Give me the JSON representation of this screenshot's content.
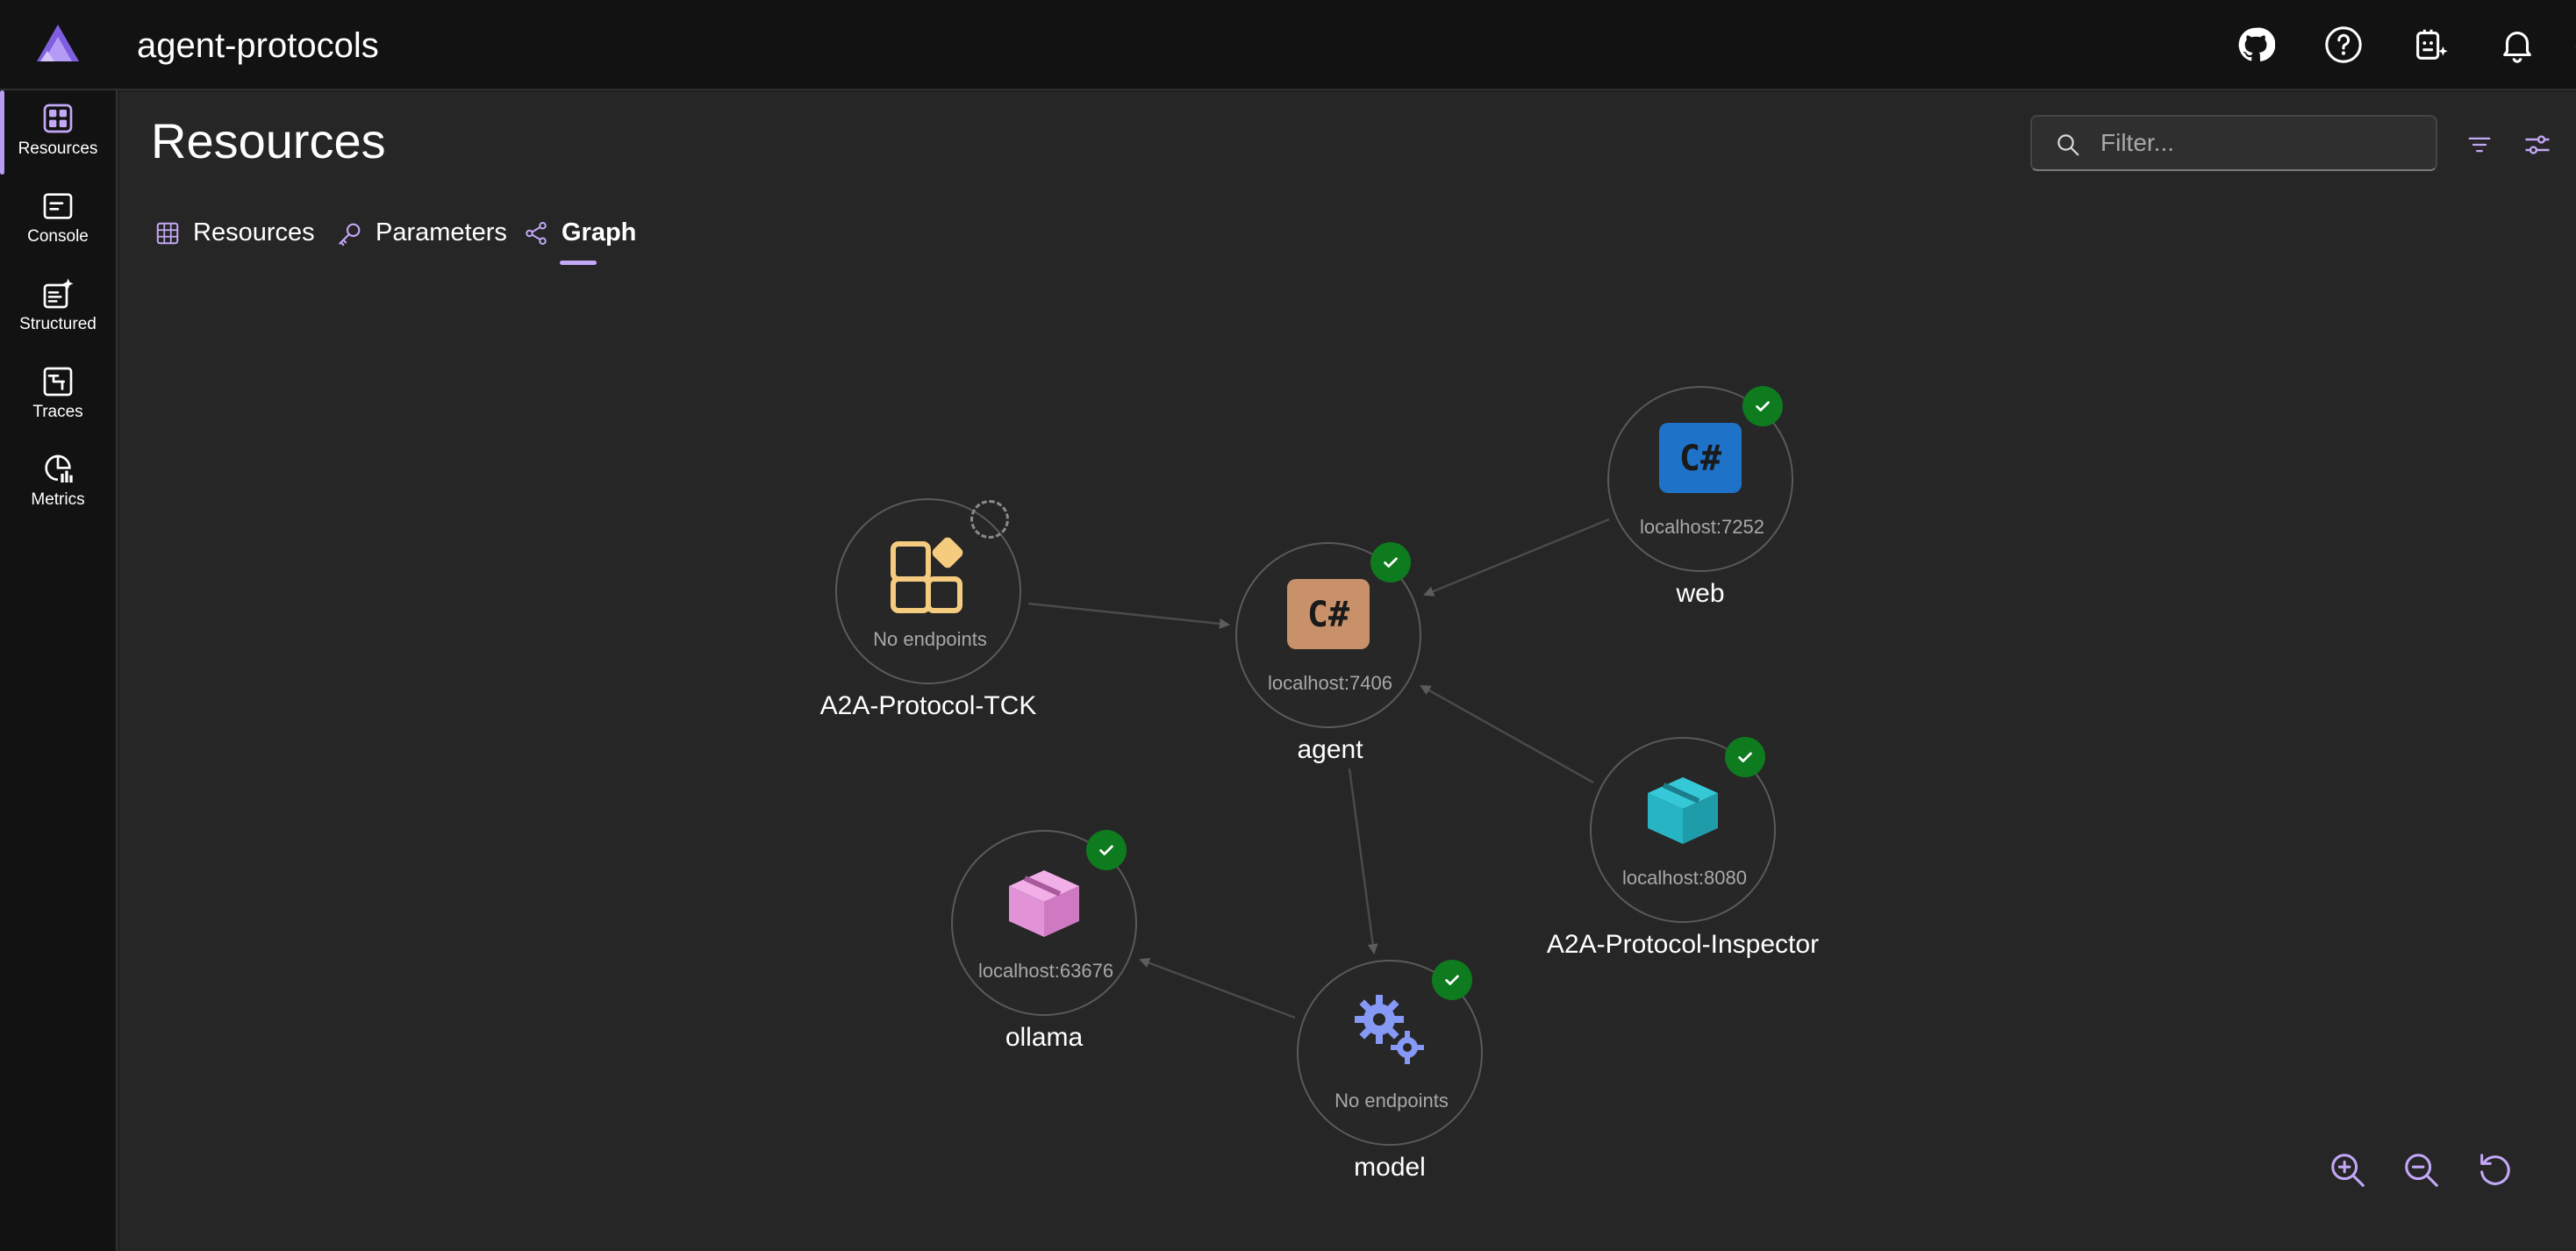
{
  "app": {
    "title": "agent-protocols"
  },
  "topbar": {
    "icons": [
      "github-icon",
      "help-icon",
      "assistant-icon",
      "bell-icon",
      "gear-icon"
    ]
  },
  "sidenav": {
    "items": [
      {
        "label": "Resources",
        "icon": "grid-icon",
        "active": true
      },
      {
        "label": "Console",
        "icon": "console-icon"
      },
      {
        "label": "Structured",
        "icon": "structured-logs-icon"
      },
      {
        "label": "Traces",
        "icon": "traces-icon"
      },
      {
        "label": "Metrics",
        "icon": "metrics-icon"
      }
    ]
  },
  "page": {
    "title": "Resources",
    "filter_placeholder": "Filter..."
  },
  "tabs": [
    {
      "label": "Resources",
      "icon": "table-icon"
    },
    {
      "label": "Parameters",
      "icon": "key-icon"
    },
    {
      "label": "Graph",
      "icon": "share-icon",
      "selected": true
    }
  ],
  "graph": {
    "nodes": [
      {
        "name": "A2A-Protocol-TCK",
        "endpoint": "No endpoints",
        "icon": "app-puzzle-icon",
        "status": "pending"
      },
      {
        "name": "agent",
        "endpoint": "localhost:7406",
        "icon": "csharp-icon",
        "status": "running"
      },
      {
        "name": "web",
        "endpoint": "localhost:7252",
        "icon": "csharp-icon",
        "status": "running"
      },
      {
        "name": "A2A-Protocol-Inspector",
        "endpoint": "localhost:8080",
        "icon": "container-icon",
        "status": "running"
      },
      {
        "name": "ollama",
        "endpoint": "localhost:63676",
        "icon": "container-icon",
        "status": "running"
      },
      {
        "name": "model",
        "endpoint": "No endpoints",
        "icon": "gears-icon",
        "status": "running"
      }
    ],
    "edges": [
      {
        "from": "A2A-Protocol-TCK",
        "to": "agent"
      },
      {
        "from": "web",
        "to": "agent"
      },
      {
        "from": "A2A-Protocol-Inspector",
        "to": "agent"
      },
      {
        "from": "agent",
        "to": "model"
      },
      {
        "from": "model",
        "to": "ollama"
      }
    ],
    "colors": {
      "status_running": "#0e7b1f",
      "csharp_agent": "#c8916a",
      "csharp_web": "#1e73c8",
      "container_inspector": "#27b5c4",
      "container_ollama": "#e292d6",
      "gears": "#8599f5",
      "puzzle": "#f5cc7f",
      "accent": "#c3a8f7"
    }
  },
  "zoom_controls": [
    "zoom-in-icon",
    "zoom-out-icon",
    "reset-icon"
  ]
}
